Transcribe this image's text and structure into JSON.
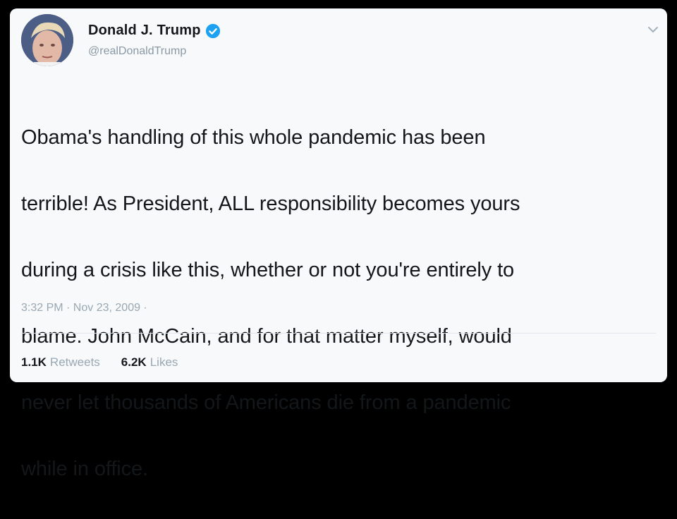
{
  "user": {
    "display_name": "Donald J. Trump",
    "handle": "@realDonaldTrump",
    "verified_icon": "verified-badge-icon",
    "verified_color": "#1da1f2"
  },
  "tweet": {
    "lines": [
      "Obama's handling of this whole pandemic has been",
      "terrible! As President, ALL responsibility becomes yours",
      "during a crisis like this, whether or not you're entirely to",
      "blame. John McCain, and for that matter myself, would",
      "never let thousands of Americans die from a pandemic",
      "while in office."
    ],
    "timestamp": "3:32 PM · Nov 23, 2009 ·"
  },
  "stats": {
    "retweets_count": "1.1K",
    "retweets_label": "Retweets",
    "likes_count": "6.2K",
    "likes_label": "Likes"
  },
  "icons": {
    "more": "chevron-down-icon"
  }
}
